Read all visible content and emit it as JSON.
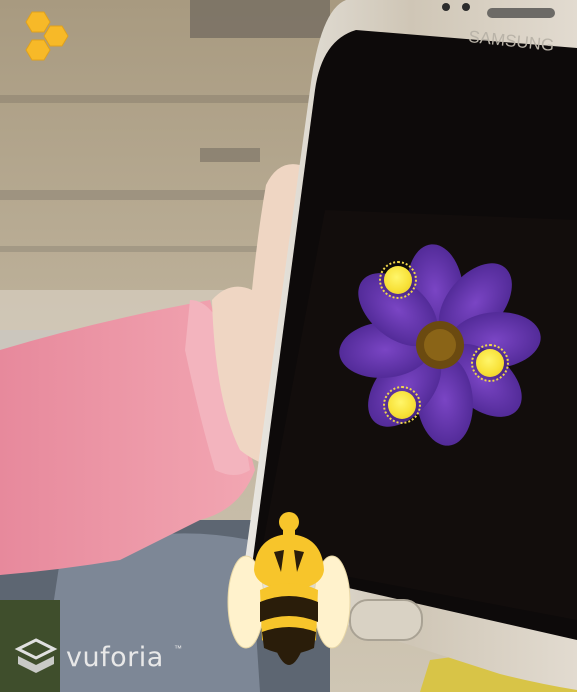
{
  "scene": {
    "description_label": "",
    "phone_brand": "SAMSUNG"
  },
  "watermark": {
    "brand": "vuforia",
    "tm": "™"
  },
  "colors": {
    "honey": "#f7b928",
    "pollen": "#f8e23a",
    "flower_petal": "#5a2fa0",
    "flower_center": "#6b4a10"
  },
  "icons": {
    "menu": "honeycomb-icon",
    "player": "bee-icon",
    "brand": "vuforia-logo-icon"
  },
  "pollen_targets": [
    {
      "id": "pollen-1"
    },
    {
      "id": "pollen-2"
    },
    {
      "id": "pollen-3"
    }
  ]
}
